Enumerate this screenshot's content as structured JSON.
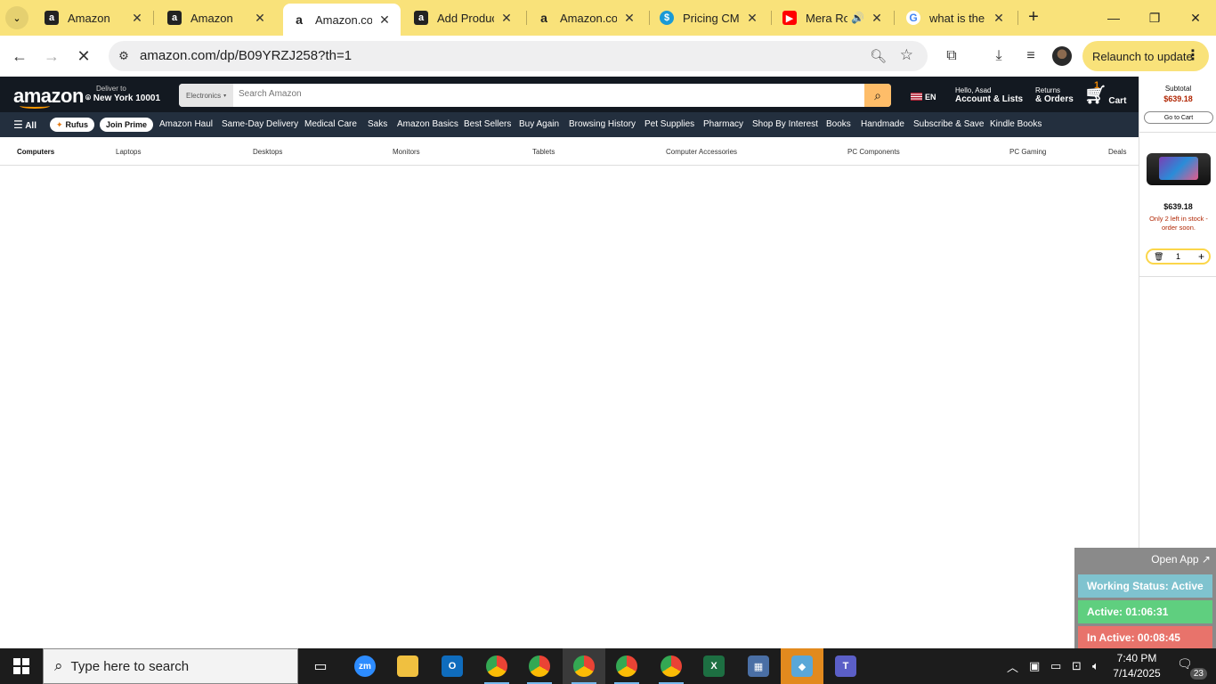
{
  "browser": {
    "tabs": [
      {
        "title": "Amazon",
        "favicon": "amazon-icon"
      },
      {
        "title": "Amazon",
        "favicon": "amazon-icon"
      },
      {
        "title": "Amazon.com",
        "favicon": "amazon-smile-icon",
        "active": true
      },
      {
        "title": "Add Product",
        "favicon": "amazon-icon"
      },
      {
        "title": "Amazon.com",
        "favicon": "amazon-smile-icon"
      },
      {
        "title": "Pricing CMS",
        "favicon": "pricing-cms-icon"
      },
      {
        "title": "Mera Ro",
        "favicon": "youtube-icon",
        "audio": true
      },
      {
        "title": "what is the n",
        "favicon": "google-icon"
      }
    ],
    "url": "amazon.com/dp/B09YRZJ258?th=1",
    "relaunch_label": "Relaunch to update",
    "colors": {
      "frame": "#f9e27a"
    }
  },
  "amazon": {
    "logo": "amazon",
    "deliver_to": "Deliver to",
    "location": "New York 10001",
    "search_category": "Electronics",
    "search_placeholder": "Search Amazon",
    "lang": "EN",
    "account_greeting": "Hello, Asad",
    "account_label": "Account & Lists",
    "returns_line1": "Returns",
    "returns_line2": "& Orders",
    "cart_count": "1",
    "cart_label": "Cart",
    "nav": {
      "all": "All",
      "rufus": "Rufus",
      "join_prime": "Join Prime",
      "items": [
        "Amazon Haul",
        "Same-Day Delivery",
        "Medical Care",
        "Saks",
        "Amazon Basics",
        "Best Sellers",
        "Buy Again",
        "Browsing History",
        "Pet Supplies",
        "Pharmacy",
        "Shop By Interest",
        "Books",
        "Handmade",
        "Subscribe & Save",
        "Kindle Books"
      ]
    },
    "categories": [
      "Computers",
      "Laptops",
      "Desktops",
      "Monitors",
      "Tablets",
      "Computer Accessories",
      "PC Components",
      "PC Gaming",
      "Deals"
    ],
    "colors": {
      "nav_bg": "#131921",
      "subnav_bg": "#232f3e",
      "search_btn": "#febd69",
      "price_red": "#b12704"
    }
  },
  "cart_panel": {
    "subtotal_label": "Subtotal",
    "subtotal_value": "$639.18",
    "go_to_cart": "Go to Cart",
    "item_price": "$639.18",
    "stock_note": "Only 2 left in stock - order soon.",
    "quantity": "1"
  },
  "status_widget": {
    "open_app": "Open App ↗",
    "working_status": "Working Status: Active",
    "active": "Active: 01:06:31",
    "inactive": "In Active: 00:08:45",
    "colors": {
      "status": "#7fc3cf",
      "active": "#5fcf7f",
      "inactive": "#e8736b"
    }
  },
  "taskbar": {
    "search_placeholder": "Type here to search",
    "time": "7:40 PM",
    "date": "7/14/2025",
    "notifications": "23"
  }
}
